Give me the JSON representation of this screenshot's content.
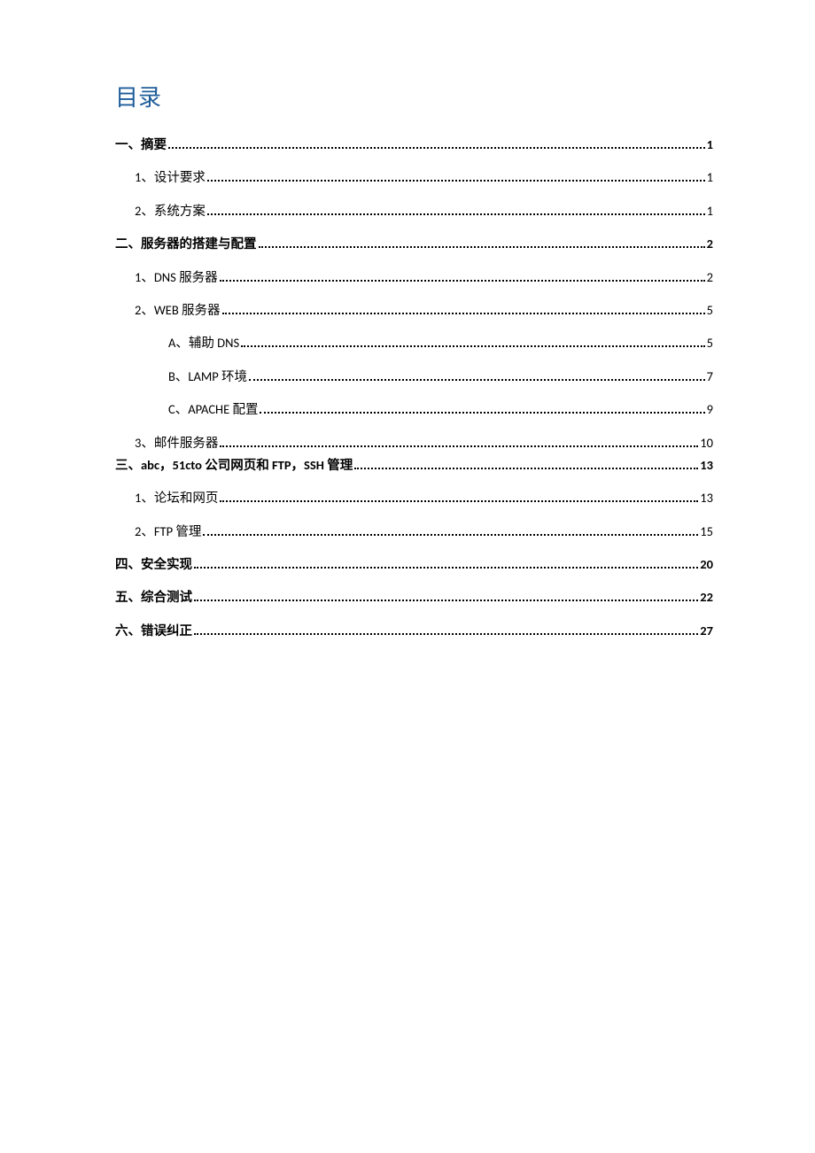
{
  "title": "目录",
  "entries": [
    {
      "level": 1,
      "bold": true,
      "label": "一、摘要",
      "page": "1"
    },
    {
      "level": 2,
      "bold": false,
      "label": "1、设计要求",
      "page": "1"
    },
    {
      "level": 2,
      "bold": false,
      "label": "2、系统方案",
      "page": "1"
    },
    {
      "level": 1,
      "bold": true,
      "label": "二、服务器的搭建与配置",
      "page": "2"
    },
    {
      "level": 2,
      "bold": false,
      "label": "1、DNS 服务器",
      "page": "2"
    },
    {
      "level": 2,
      "bold": false,
      "label": "2、WEB 服务器",
      "page": "5"
    },
    {
      "level": 3,
      "bold": false,
      "label": "A、辅助 DNS",
      "page": "5"
    },
    {
      "level": 3,
      "bold": false,
      "label": "B、LAMP 环境",
      "page": "7"
    },
    {
      "level": 3,
      "bold": false,
      "label": "C、APACHE 配置",
      "page": "9"
    },
    {
      "level": 2,
      "bold": false,
      "label": "3、邮件服务器",
      "page": "10",
      "tight": true
    },
    {
      "level": 1,
      "bold": true,
      "label": "三、abc，51cto 公司网页和 FTP，SSH 管理",
      "page": "13"
    },
    {
      "level": 2,
      "bold": false,
      "label": "1、论坛和网页",
      "page": "13"
    },
    {
      "level": 2,
      "bold": false,
      "label": "2、FTP 管理",
      "page": "15"
    },
    {
      "level": 1,
      "bold": true,
      "label": "四、安全实现",
      "page": "20"
    },
    {
      "level": 1,
      "bold": true,
      "label": "五、综合测试",
      "page": "22"
    },
    {
      "level": 1,
      "bold": true,
      "label": "六、错误纠正",
      "page": "27"
    }
  ]
}
